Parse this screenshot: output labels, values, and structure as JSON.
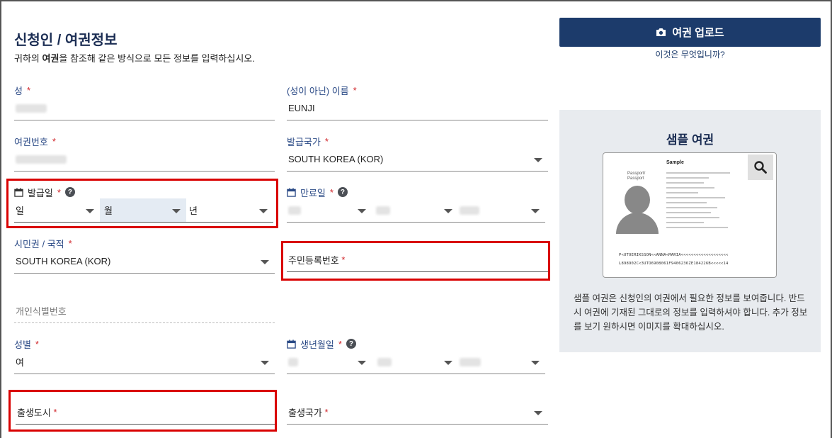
{
  "page": {
    "title": "신청인 / 여권정보",
    "subtitle_prefix": "귀하의 ",
    "subtitle_bold": "여권",
    "subtitle_suffix": "을 참조해 같은 방식으로 모든 정보를 입력하십시오."
  },
  "fields": {
    "surname": {
      "label": "성",
      "required": "*",
      "value": ""
    },
    "given_name": {
      "label": "(성이 아닌) 이름",
      "required": "*",
      "value": "EUNJI"
    },
    "passport_no": {
      "label": "여권번호",
      "required": "*",
      "value": ""
    },
    "issuing_country": {
      "label": "발급국가",
      "required": "*",
      "value": "SOUTH KOREA (KOR)"
    },
    "issue_date": {
      "label": "발급일",
      "required": "*",
      "day": "일",
      "month": "월",
      "year": "년"
    },
    "expiry_date": {
      "label": "만료일",
      "required": "*"
    },
    "citizenship": {
      "label": "시민권 / 국적",
      "required": "*",
      "value": "SOUTH KOREA (KOR)"
    },
    "resident_reg_no": {
      "label": "주민등록번호",
      "required": "*"
    },
    "personal_id": {
      "placeholder": "개인식별번호"
    },
    "sex": {
      "label": "성별",
      "required": "*",
      "value": "여"
    },
    "birth_date": {
      "label": "생년월일",
      "required": "*"
    },
    "birth_city": {
      "label": "출생도시",
      "required": "*"
    },
    "birth_country": {
      "label": "출생국가",
      "required": "*"
    }
  },
  "upload": {
    "button_label": "여권 업로드",
    "icon": "camera-icon",
    "what_is_link": "이것은 무엇입니까?"
  },
  "sample": {
    "title": "샘플 여권",
    "passport_heading": "Sample",
    "passport_type_label": "Passport/ Passport",
    "mrz_line1": "P<UTOERIKSSON<<ANNA<MARIA<<<<<<<<<<<<<<<<<<<",
    "mrz_line2": "L898902C<3UTO6908061F9406236ZE184226B<<<<<14",
    "description": "샘플 여권은 신청인의 여권에서 필요한 정보를 보여줍니다. 반드시 여권에 기재된 그대로의 정보를 입력하셔야 합니다. 추가 정보를 보기 원하시면 이미지를 확대하십시오."
  },
  "colors": {
    "accent": "#1c3b6b",
    "label": "#2b4a86",
    "required": "#d1262b",
    "highlight_box": "#d90000",
    "panel_bg": "#e8ebef"
  }
}
